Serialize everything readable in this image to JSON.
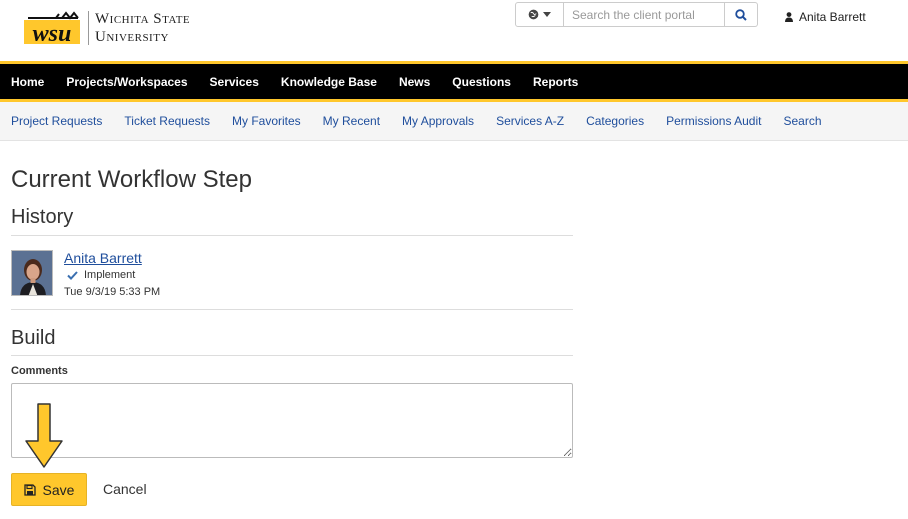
{
  "brand": {
    "line1": "Wichita State",
    "line2": "University",
    "mark": "WSU"
  },
  "search": {
    "placeholder": "Search the client portal"
  },
  "user": {
    "name": "Anita Barrett"
  },
  "main_nav": {
    "items": [
      "Home",
      "Projects/Workspaces",
      "Services",
      "Knowledge Base",
      "News",
      "Questions",
      "Reports"
    ]
  },
  "sub_nav": {
    "items": [
      "Project Requests",
      "Ticket Requests",
      "My Favorites",
      "My Recent",
      "My Approvals",
      "Services A-Z",
      "Categories",
      "Permissions Audit",
      "Search"
    ]
  },
  "page": {
    "title": "Current Workflow Step",
    "history_title": "History",
    "build_title": "Build"
  },
  "history": {
    "name": "Anita Barrett",
    "action": "Implement",
    "timestamp": "Tue 9/3/19 5:33 PM"
  },
  "form": {
    "comments_label": "Comments",
    "comments_value": "",
    "save_label": "Save",
    "cancel_label": "Cancel"
  },
  "colors": {
    "accent": "#ffc72c",
    "nav_bg": "#000000",
    "link": "#1f4e9c"
  },
  "icons": {
    "globe": "globe-icon",
    "caret": "caret-down-icon",
    "search": "search-icon",
    "user": "user-icon",
    "check": "check-icon",
    "save": "floppy-disk-icon",
    "arrow": "arrow-down-icon"
  }
}
